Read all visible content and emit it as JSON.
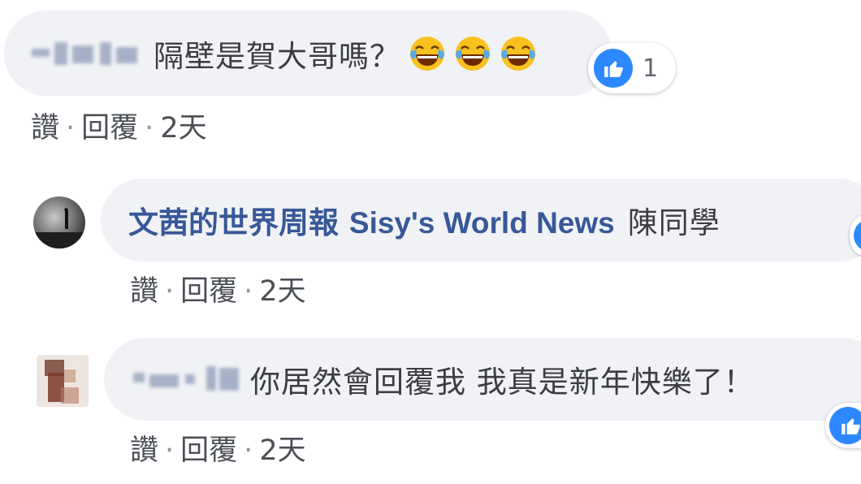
{
  "comments": [
    {
      "text": "隔壁是賀大哥嗎？",
      "emoji": "face-with-tears-of-joy",
      "emoji_count": 3,
      "reaction_count": "1",
      "actions": {
        "like": "讚",
        "reply": "回覆",
        "time": "2天"
      }
    },
    {
      "author": "文茜的世界周報",
      "author_latin": "Sisy's World News",
      "text": "陳同學",
      "actions": {
        "like": "讚",
        "reply": "回覆",
        "time": "2天"
      }
    },
    {
      "text": "你居然會回覆我 我真是新年快樂了！",
      "actions": {
        "like": "讚",
        "reply": "回覆",
        "time": "2天"
      }
    }
  ],
  "separator": "·",
  "colors": {
    "bubble": "#f0f2f5",
    "link": "#385898",
    "like_blue": "#2d88ff",
    "emoji_yellow": "#f8c11d"
  }
}
